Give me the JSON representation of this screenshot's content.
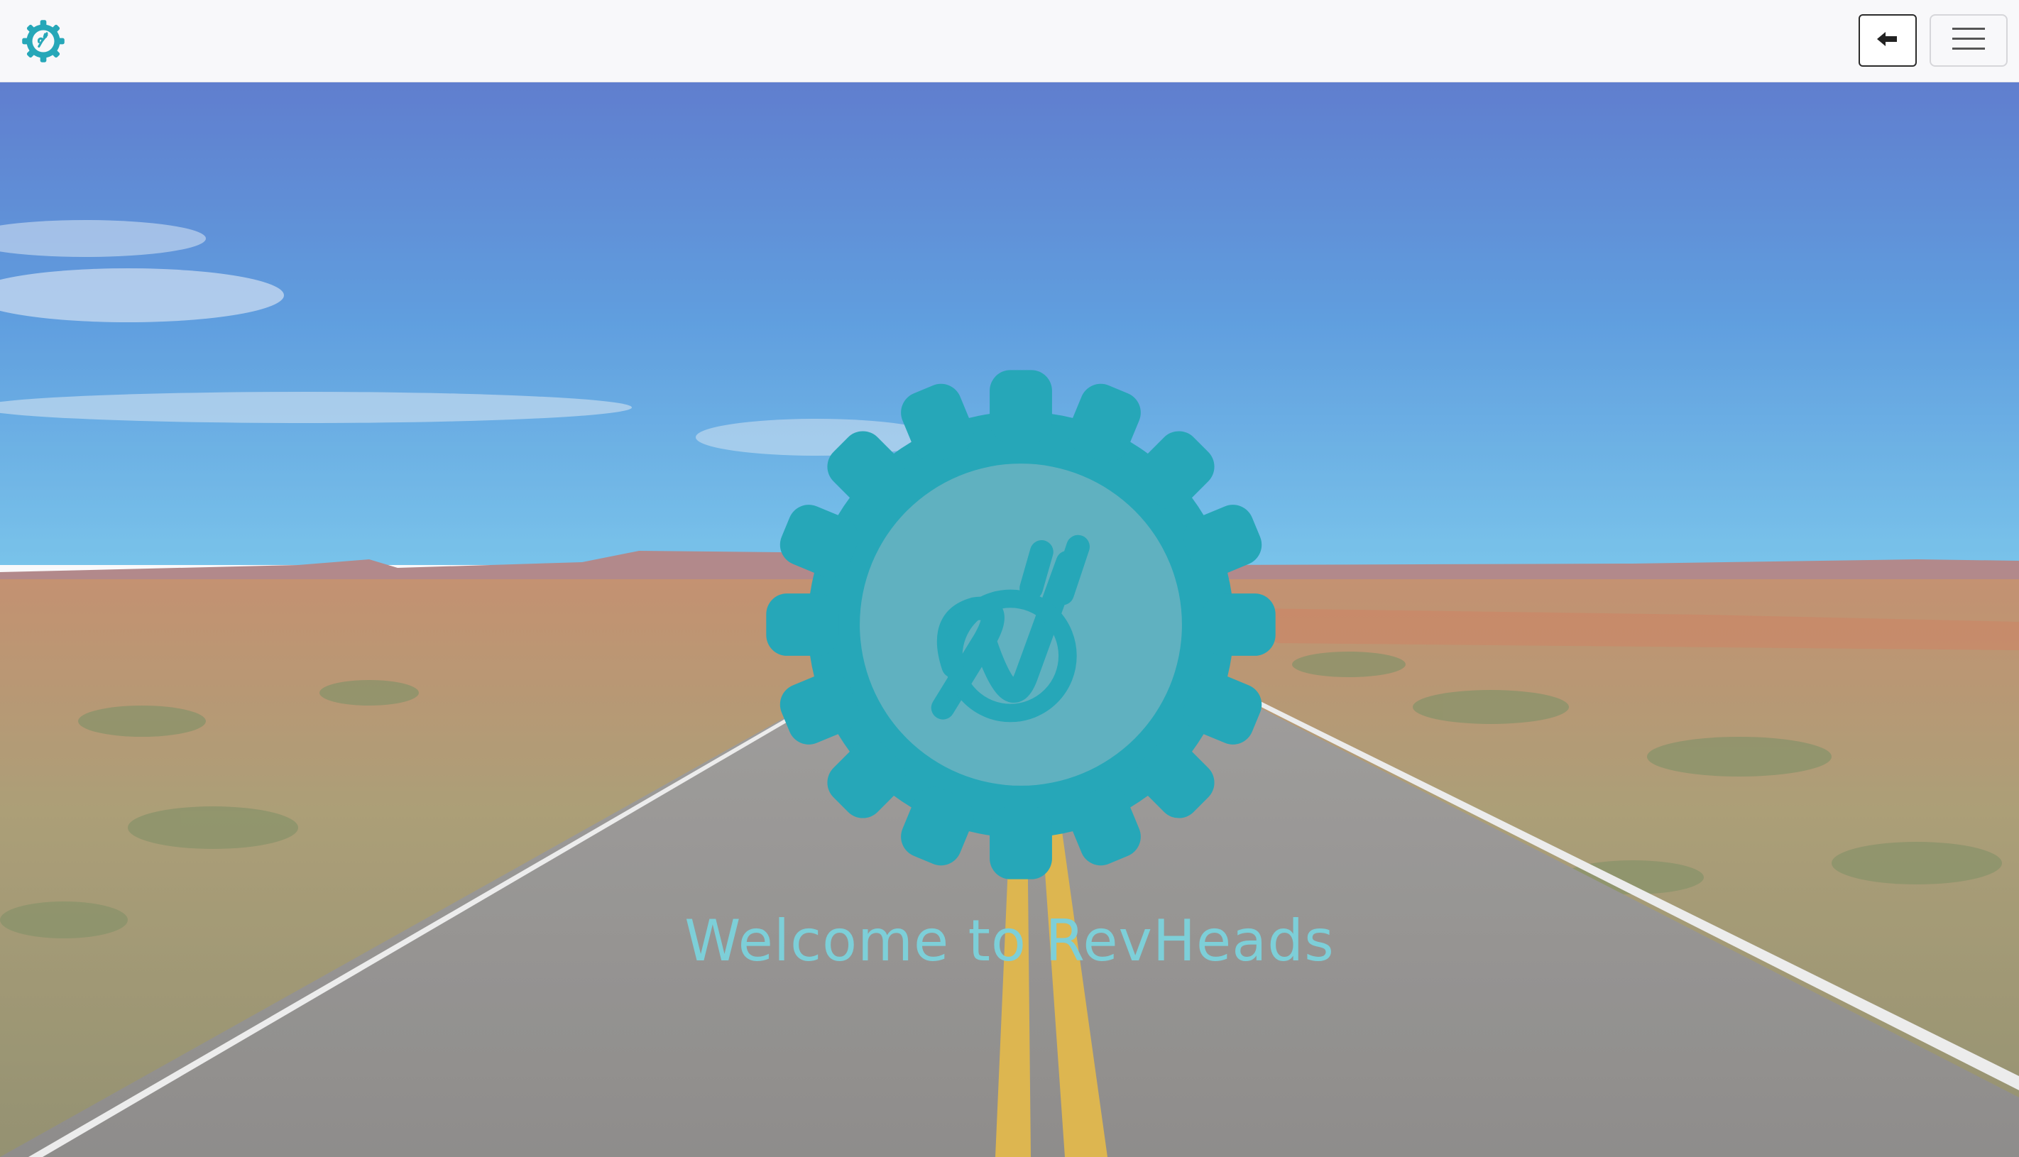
{
  "navbar": {
    "logo_icon": "revheads-gear-icon",
    "back_icon": "arrow-left-icon",
    "menu_icon": "hamburger-menu-icon"
  },
  "hero": {
    "title": "Welcome to RevHeads",
    "logo_icon": "revheads-gear-icon",
    "background": "desert-road-photo"
  },
  "colors": {
    "brand": "#26a7b8",
    "title": "#7dcfd8",
    "navbar_bg": "#f8f8fa"
  }
}
